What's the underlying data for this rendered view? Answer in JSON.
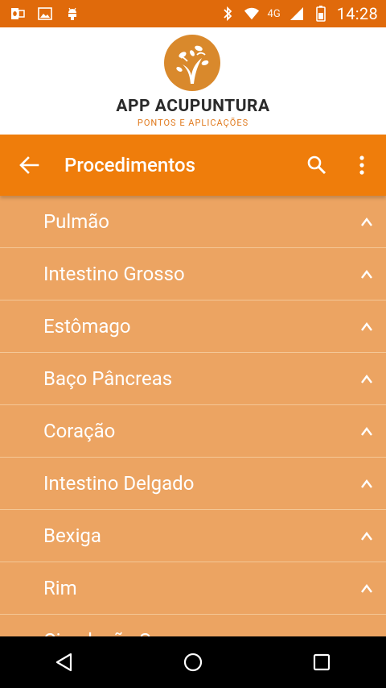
{
  "status_bar": {
    "network_label": "4G",
    "time": "14:28",
    "icons": [
      "outlook-icon",
      "image-icon",
      "android-icon",
      "bluetooth-icon",
      "wifi-icon",
      "signal-icon",
      "battery-icon"
    ]
  },
  "brand": {
    "title": "APP ACUPUNTURA",
    "subtitle": "PONTOS E APLICAÇÕES",
    "accent_color": "#d9892c"
  },
  "app_bar": {
    "title": "Procedimentos",
    "color": "#ef7d0b"
  },
  "list": {
    "background": "#eca462",
    "items": [
      {
        "label": "Pulmão"
      },
      {
        "label": "Intestino Grosso"
      },
      {
        "label": "Estômago"
      },
      {
        "label": "Baço Pâncreas"
      },
      {
        "label": "Coração"
      },
      {
        "label": "Intestino Delgado"
      },
      {
        "label": "Bexiga"
      },
      {
        "label": "Rim"
      },
      {
        "label": "Circulação Sexo"
      }
    ]
  },
  "nav_bar": {
    "icons": [
      "back-triangle-icon",
      "home-circle-icon",
      "recents-square-icon"
    ]
  }
}
